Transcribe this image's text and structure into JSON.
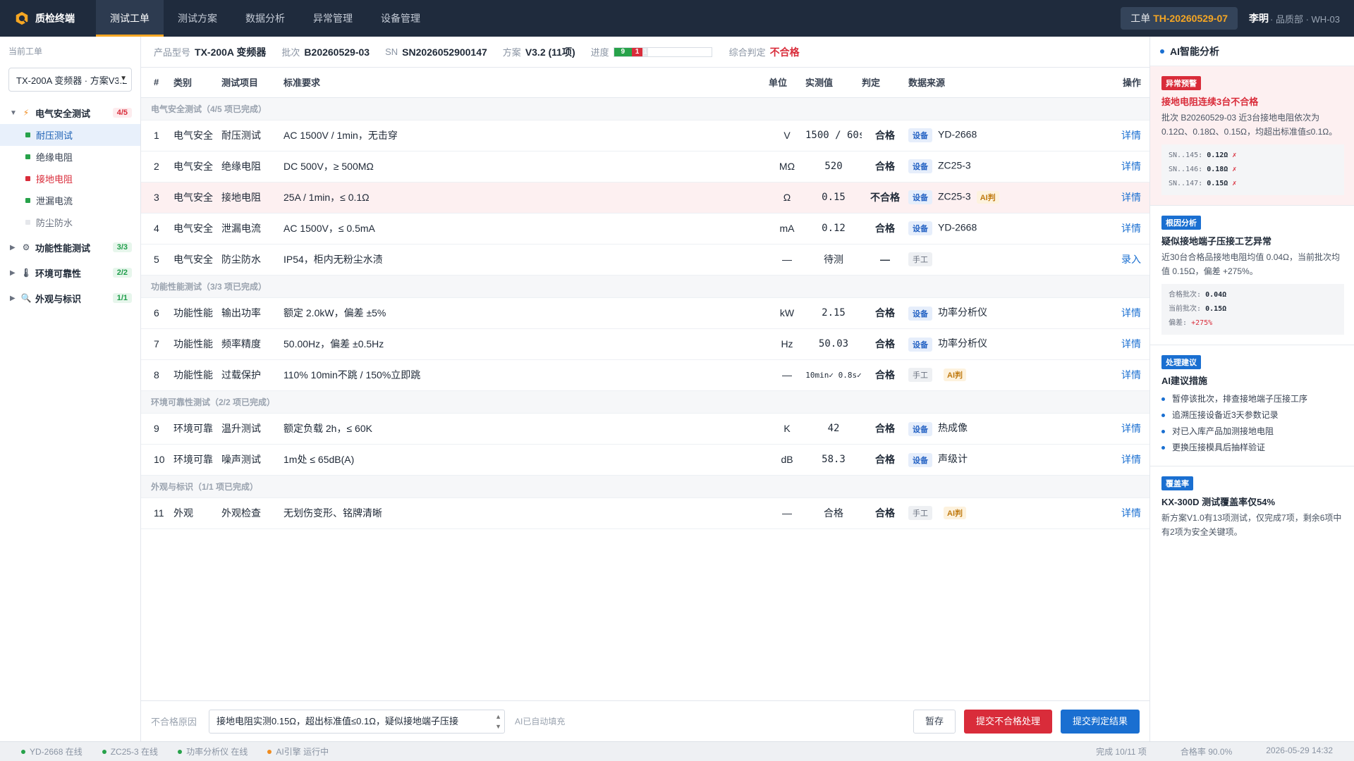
{
  "app": {
    "brand": "质检终端"
  },
  "nav": [
    {
      "label": "测试工单",
      "active": true
    },
    {
      "label": "测试方案",
      "active": false
    },
    {
      "label": "数据分析",
      "active": false
    },
    {
      "label": "异常管理",
      "active": false
    },
    {
      "label": "设备管理",
      "active": false
    }
  ],
  "header": {
    "order_prefix": "工单",
    "order_id": "TH-20260529-07",
    "user_name": "李明",
    "user_meta": " · 品质部 · WH-03"
  },
  "sidebar": {
    "title": "当前工单",
    "select_value": "TX-200A 变频器 · 方案V3.2",
    "groups": [
      {
        "label": "电气安全测试",
        "count": "4/5",
        "icon": "bolt-icon",
        "expanded": true,
        "items": [
          {
            "label": "耐压测试",
            "status": "pass",
            "selected": true
          },
          {
            "label": "绝缘电阻",
            "status": "pass",
            "selected": false
          },
          {
            "label": "接地电阻",
            "status": "fail",
            "selected": false
          },
          {
            "label": "泄漏电流",
            "status": "pass",
            "selected": false
          },
          {
            "label": "防尘防水",
            "status": "pending",
            "selected": false
          }
        ]
      },
      {
        "label": "功能性能测试",
        "count": "3/3",
        "icon": "gear-icon",
        "expanded": false,
        "items": []
      },
      {
        "label": "环境可靠性",
        "count": "2/2",
        "icon": "thermometer-icon",
        "expanded": false,
        "items": []
      },
      {
        "label": "外观与标识",
        "count": "1/1",
        "icon": "magnifier-icon",
        "expanded": false,
        "items": []
      }
    ]
  },
  "infobar": {
    "model_label": "产品型号",
    "model": "TX-200A 变频器",
    "batch_label": "批次",
    "batch": "B20260529-03",
    "sn_label": "SN",
    "sn": "SN2026052900147",
    "plan_label": "方案",
    "plan": "V3.2 (11项)",
    "progress_label": "进度",
    "progress": {
      "pass": 9,
      "fail": 1,
      "pending": 1,
      "total": 11
    },
    "verdict_label": "综合判定",
    "verdict": "不合格"
  },
  "table": {
    "headers": [
      "#",
      "类别",
      "测试项目",
      "标准要求",
      "单位",
      "实测值",
      "判定",
      "数据来源",
      "操作"
    ],
    "sections": [
      {
        "title": "电气安全测试（4/5 项已完成）",
        "rows": [
          {
            "n": "1",
            "cat": "电气安全",
            "item": "耐压测试",
            "std": "AC 1500V / 1min，无击穿",
            "unit": "V",
            "meas": "1500 / 60s",
            "judge": "合格",
            "src_type": "设备",
            "src": "YD-2668",
            "ai": "",
            "op": "详情",
            "fail": false
          },
          {
            "n": "2",
            "cat": "电气安全",
            "item": "绝缘电阻",
            "std": "DC 500V，≥ 500MΩ",
            "unit": "MΩ",
            "meas": "520",
            "judge": "合格",
            "src_type": "设备",
            "src": "ZC25-3",
            "ai": "",
            "op": "详情",
            "fail": false
          },
          {
            "n": "3",
            "cat": "电气安全",
            "item": "接地电阻",
            "std": "25A / 1min，≤ 0.1Ω",
            "unit": "Ω",
            "meas": "0.15",
            "judge": "不合格",
            "src_type": "设备",
            "src": "ZC25-3",
            "ai": "AI判",
            "op": "详情",
            "fail": true
          },
          {
            "n": "4",
            "cat": "电气安全",
            "item": "泄漏电流",
            "std": "AC 1500V，≤ 0.5mA",
            "unit": "mA",
            "meas": "0.12",
            "judge": "合格",
            "src_type": "设备",
            "src": "YD-2668",
            "ai": "",
            "op": "详情",
            "fail": false
          },
          {
            "n": "5",
            "cat": "电气安全",
            "item": "防尘防水",
            "std": "IP54，柜内无粉尘水渍",
            "unit": "—",
            "meas": "待测",
            "judge": "—",
            "src_type": "手工",
            "src": "",
            "ai": "",
            "op": "录入",
            "fail": false
          }
        ]
      },
      {
        "title": "功能性能测试（3/3 项已完成）",
        "rows": [
          {
            "n": "6",
            "cat": "功能性能",
            "item": "输出功率",
            "std": "额定 2.0kW，偏差 ±5%",
            "unit": "kW",
            "meas": "2.15",
            "judge": "合格",
            "src_type": "设备",
            "src": "功率分析仪",
            "ai": "",
            "op": "详情",
            "fail": false
          },
          {
            "n": "7",
            "cat": "功能性能",
            "item": "频率精度",
            "std": "50.00Hz，偏差 ±0.5Hz",
            "unit": "Hz",
            "meas": "50.03",
            "judge": "合格",
            "src_type": "设备",
            "src": "功率分析仪",
            "ai": "",
            "op": "详情",
            "fail": false
          },
          {
            "n": "8",
            "cat": "功能性能",
            "item": "过载保护",
            "std": "110% 10min不跳 / 150%立即跳",
            "unit": "—",
            "meas": "10min✓ 0.8s✓",
            "judge": "合格",
            "src_type": "手工",
            "src": "",
            "ai": "AI判",
            "op": "详情",
            "fail": false
          }
        ]
      },
      {
        "title": "环境可靠性测试（2/2 项已完成）",
        "rows": [
          {
            "n": "9",
            "cat": "环境可靠",
            "item": "温升测试",
            "std": "额定负载 2h，≤ 60K",
            "unit": "K",
            "meas": "42",
            "judge": "合格",
            "src_type": "设备",
            "src": "热成像",
            "ai": "",
            "op": "详情",
            "fail": false
          },
          {
            "n": "10",
            "cat": "环境可靠",
            "item": "噪声测试",
            "std": "1m处 ≤ 65dB(A)",
            "unit": "dB",
            "meas": "58.3",
            "judge": "合格",
            "src_type": "设备",
            "src": "声级计",
            "ai": "",
            "op": "详情",
            "fail": false
          }
        ]
      },
      {
        "title": "外观与标识（1/1 项已完成）",
        "rows": [
          {
            "n": "11",
            "cat": "外观",
            "item": "外观检查",
            "std": "无划伤变形、铭牌清晰",
            "unit": "—",
            "meas": "合格",
            "judge": "合格",
            "src_type": "手工",
            "src": "",
            "ai": "AI判",
            "op": "详情",
            "fail": false
          }
        ]
      }
    ]
  },
  "actionbar": {
    "reason_label": "不合格原因",
    "reason_value": "接地电阻实测0.15Ω，超出标准值≤0.1Ω，疑似接地端子压接",
    "auto_note": "AI已自动填充",
    "pause": "暂存",
    "submit_fail": "提交不合格处理",
    "submit": "提交判定结果"
  },
  "ai_panel": {
    "title": "AI智能分析",
    "cards": [
      {
        "badge": "异常预警",
        "kind": "alert",
        "title": "接地电阻连续3台不合格",
        "text": "批次 B20260529-03 近3台接地电阻依次为0.12Ω、0.18Ω、0.15Ω，均超出标准值≤0.1Ω。",
        "mini": [
          {
            "k": "SN..145:",
            "v": "0.12Ω",
            "x": "✗"
          },
          {
            "k": "SN..146:",
            "v": "0.18Ω",
            "x": "✗"
          },
          {
            "k": "SN..147:",
            "v": "0.15Ω",
            "x": "✗"
          }
        ]
      },
      {
        "badge": "根因分析",
        "kind": "normal",
        "title": "疑似接地端子压接工艺异常",
        "text": "近30台合格品接地电阻均值 0.04Ω，当前批次均值 0.15Ω，偏差 +275%。",
        "mini": [
          {
            "k": "合格批次:",
            "v": "0.04Ω",
            "x": ""
          },
          {
            "k": "当前批次:",
            "v": "0.15Ω",
            "x": ""
          },
          {
            "k": "偏差:",
            "v": "",
            "x": "+275%"
          }
        ]
      },
      {
        "badge": "处理建议",
        "kind": "normal",
        "title": "AI建议措施",
        "text": "",
        "bullets": [
          "暂停该批次，排查接地端子压接工序",
          "追溯压接设备近3天参数记录",
          "对已入库产品加测接地电阻",
          "更换压接模具后抽样验证"
        ]
      },
      {
        "badge": "覆盖率",
        "kind": "normal",
        "title": "KX-300D 测试覆盖率仅54%",
        "text": "新方案V1.0有13项测试，仅完成7项，剩余6项中有2项为安全关键项。"
      }
    ]
  },
  "statusbar": {
    "items": [
      {
        "label": "YD-2668 在线",
        "color": "#27a24a"
      },
      {
        "label": "ZC25-3 在线",
        "color": "#27a24a"
      },
      {
        "label": "功率分析仪 在线",
        "color": "#27a24a"
      },
      {
        "label": "AI引擎 运行中",
        "color": "#f08c1f"
      }
    ],
    "done": "完成 10/11 项",
    "rate": "合格率 90.0%",
    "time": "2026-05-29 14:32"
  },
  "colors": {
    "accent": "#1a6fd1",
    "fail": "#d92c3a",
    "pass": "#27a24a",
    "topbar": "#1f2b3d",
    "brand": "#f5a623"
  }
}
